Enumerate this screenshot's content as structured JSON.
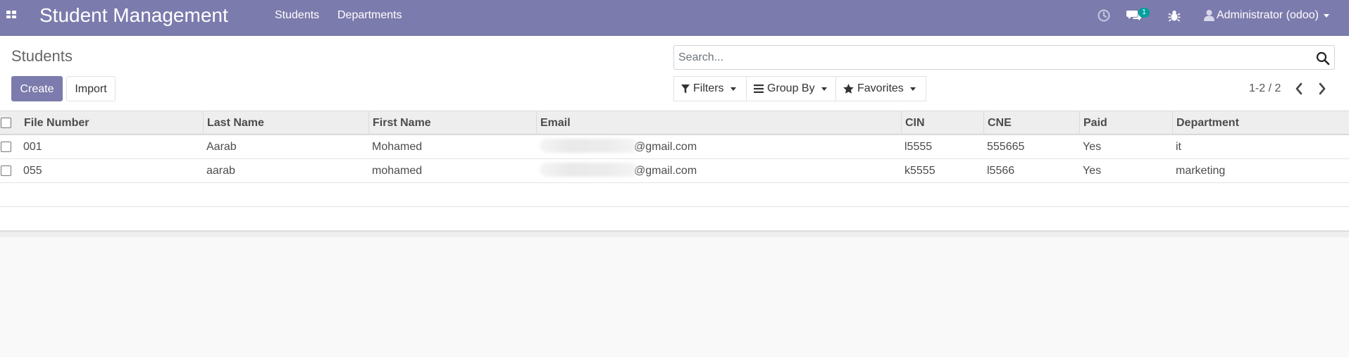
{
  "app": {
    "title": "Student Management",
    "brand_color": "#7c7bad"
  },
  "nav": {
    "menus": [
      "Students",
      "Departments"
    ],
    "messages_badge": "1",
    "user": "Administrator (odoo)"
  },
  "control_panel": {
    "breadcrumb": "Students",
    "create_label": "Create",
    "import_label": "Import",
    "search_placeholder": "Search...",
    "filters_label": "Filters",
    "group_by_label": "Group By",
    "favorites_label": "Favorites",
    "pager": "1-2 / 2"
  },
  "table": {
    "columns": [
      "File Number",
      "Last Name",
      "First Name",
      "Email",
      "CIN",
      "CNE",
      "Paid",
      "Department"
    ],
    "rows": [
      {
        "file_number": "001",
        "last_name": "Aarab",
        "first_name": "Mohamed",
        "email_suffix": "@gmail.com",
        "cin": "l5555",
        "cne": "555665",
        "paid": "Yes",
        "department": "it"
      },
      {
        "file_number": "055",
        "last_name": "aarab",
        "first_name": "mohamed",
        "email_suffix": "@gmail.com",
        "cin": "k5555",
        "cne": "l5566",
        "paid": "Yes",
        "department": "marketing"
      }
    ]
  },
  "icons": {
    "apps": "apps-grid-icon",
    "activity": "clock-icon",
    "messages": "chat-icon",
    "debug": "bug-icon",
    "user": "user-icon",
    "search": "search-icon",
    "filters": "filter-icon",
    "group_by": "list-icon",
    "favorites": "star-icon",
    "prev": "chevron-left-icon",
    "next": "chevron-right-icon"
  }
}
